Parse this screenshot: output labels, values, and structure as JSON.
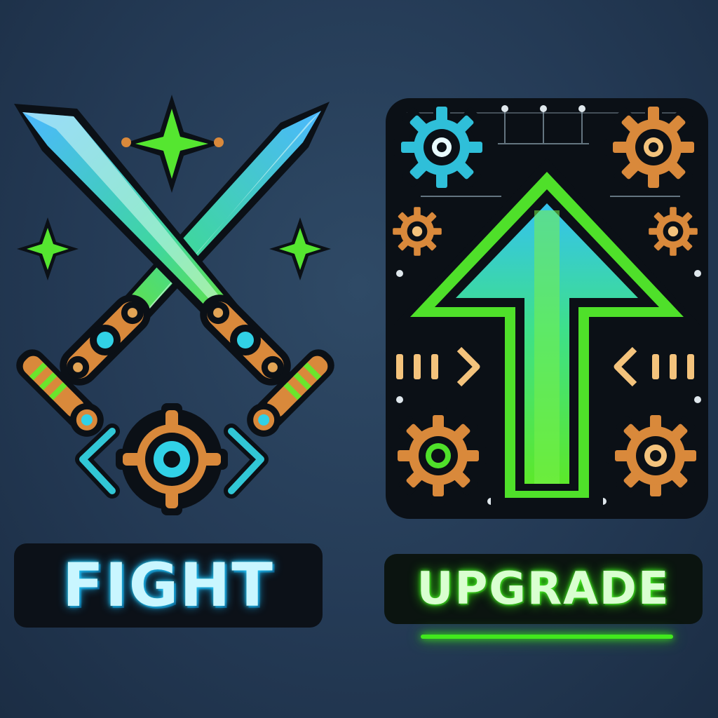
{
  "buttons": {
    "fight": {
      "label": "FIGHT"
    },
    "upgrade": {
      "label": "UPGRADE"
    }
  },
  "icons": {
    "fight": [
      "crossed-swords-icon",
      "sparkle-icon",
      "target-icon",
      "left-arrow-icon",
      "right-arrow-icon"
    ],
    "upgrade": [
      "up-arrow-icon",
      "gear-icon",
      "left-arrow-icon",
      "right-arrow-icon"
    ]
  },
  "colors": {
    "background": "#243a55",
    "fight_text": "#c9f6ff",
    "fight_glow": "#27d8ff",
    "upgrade_text": "#d9ffd0",
    "upgrade_glow": "#52ff2e",
    "bronze": "#d9893b",
    "blade_blue": "#3fa6ee",
    "blade_green": "#63e02a"
  }
}
